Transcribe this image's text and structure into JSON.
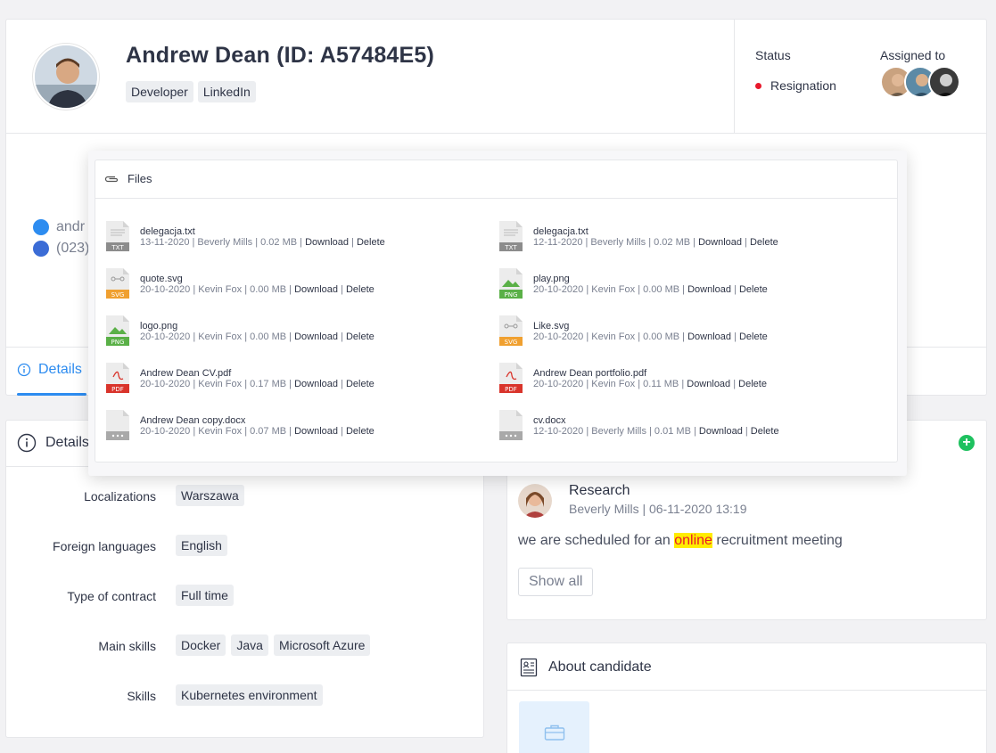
{
  "candidate": {
    "name": "Andrew Dean (ID: A57484E5)",
    "tags": [
      "Developer",
      "LinkedIn"
    ],
    "status_label": "Status",
    "status_value": "Resignation",
    "assigned_label": "Assigned to",
    "email_partial": "andr",
    "phone_partial": "(023)"
  },
  "tabs": {
    "details": "Details"
  },
  "details": {
    "title": "Details",
    "rows": [
      {
        "label": "Localizations",
        "values": [
          "Warszawa"
        ]
      },
      {
        "label": "Foreign languages",
        "values": [
          "English"
        ]
      },
      {
        "label": "Type of contract",
        "values": [
          "Full time"
        ]
      },
      {
        "label": "Main skills",
        "values": [
          "Docker",
          "Java",
          "Microsoft Azure"
        ]
      },
      {
        "label": "Skills",
        "values": [
          "Kubernetes environment"
        ]
      }
    ]
  },
  "research": {
    "title": "Research",
    "meta": "Beverly Mills | 06-11-2020 13:19",
    "text_before": "we are scheduled for an ",
    "text_highlight": "online",
    "text_after": " recruitment meeting",
    "show_all": "Show all"
  },
  "about": {
    "title": "About candidate"
  },
  "files": {
    "title": "Files",
    "download": "Download",
    "delete": "Delete",
    "items": [
      {
        "name": "delegacja.txt",
        "info": "13-11-2020 | Beverly Mills | 0.02 MB",
        "type": "TXT",
        "color": "#8c8c8c"
      },
      {
        "name": "delegacja.txt",
        "info": "12-11-2020 | Beverly Mills | 0.02 MB",
        "type": "TXT",
        "color": "#8c8c8c"
      },
      {
        "name": "quote.svg",
        "info": "20-10-2020 | Kevin Fox | 0.00 MB",
        "type": "SVG",
        "color": "#f0a030"
      },
      {
        "name": "play.png",
        "info": "20-10-2020 | Kevin Fox | 0.00 MB",
        "type": "PNG",
        "color": "#5ab047"
      },
      {
        "name": "logo.png",
        "info": "20-10-2020 | Kevin Fox | 0.00 MB",
        "type": "PNG",
        "color": "#5ab047"
      },
      {
        "name": "Like.svg",
        "info": "20-10-2020 | Kevin Fox | 0.00 MB",
        "type": "SVG",
        "color": "#f0a030"
      },
      {
        "name": "Andrew Dean CV.pdf",
        "info": "20-10-2020 | Kevin Fox | 0.17 MB",
        "type": "PDF",
        "color": "#d9342b"
      },
      {
        "name": "Andrew Dean portfolio.pdf",
        "info": "20-10-2020 | Kevin Fox | 0.11 MB",
        "type": "PDF",
        "color": "#d9342b"
      },
      {
        "name": "Andrew Dean copy.docx",
        "info": "20-10-2020 | Kevin Fox | 0.07 MB",
        "type": "",
        "color": "#a9a9a9"
      },
      {
        "name": "cv.docx",
        "info": "12-10-2020 | Beverly Mills | 0.01 MB",
        "type": "",
        "color": "#a9a9a9"
      }
    ]
  },
  "colors": {
    "accent": "#2d8cf0",
    "status_dot": "#e8192c",
    "add_button": "#1ec15f",
    "highlight_bg": "#ffec00"
  }
}
